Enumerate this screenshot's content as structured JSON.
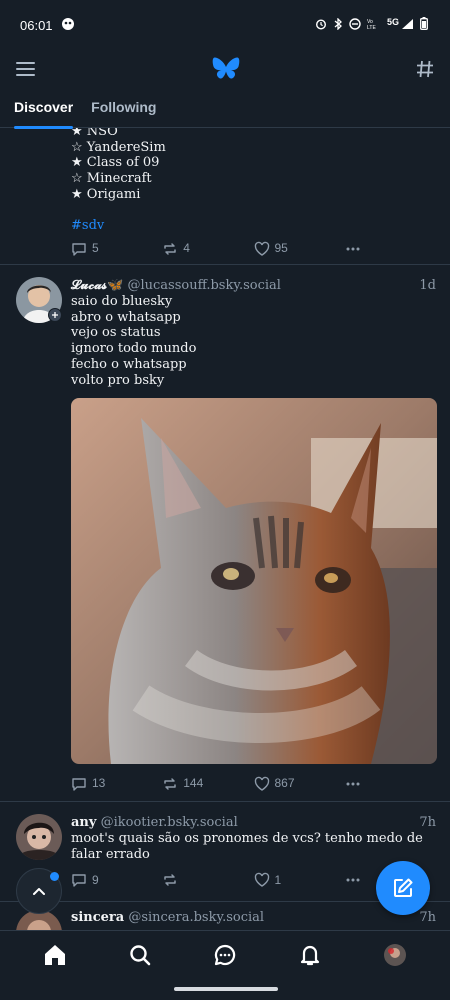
{
  "status_bar": {
    "time": "06:01",
    "network": "5G"
  },
  "header": {
    "menu_icon": "menu-icon",
    "logo": "butterfly-logo",
    "feeds_icon": "hash-icon"
  },
  "tabs": [
    {
      "label": "Discover",
      "active": true
    },
    {
      "label": "Following",
      "active": false
    }
  ],
  "posts": [
    {
      "lines": [
        "★ NSO",
        "☆ YandereSim",
        "★ Class of 09",
        "☆ Minecraft",
        "★ Origami"
      ],
      "hashtag": "#sdv",
      "replies": "5",
      "reposts": "4",
      "likes": "95"
    },
    {
      "author": "𝓛𝓾𝓬𝓪𝓼🦋",
      "handle": "@lucassouff.bsky.social",
      "time": "1d",
      "lines": [
        "saio do bluesky",
        "abro o whatsapp",
        "vejo os status",
        "ignoro todo mundo",
        "fecho o whatsapp",
        "volto pro bsky"
      ],
      "replies": "13",
      "reposts": "144",
      "likes": "867"
    },
    {
      "author": "any",
      "handle": "@ikootier.bsky.social",
      "time": "7h",
      "text": "moot's quais são os pronomes de vcs? tenho medo de falar errado",
      "replies": "9",
      "reposts": "",
      "likes": "1"
    },
    {
      "author": "sincera",
      "handle": "@sincera.bsky.social",
      "time": "7h"
    }
  ],
  "colors": {
    "background": "#161e27",
    "accent": "#208bfe",
    "muted": "#8d9aa8",
    "divider": "#2e3a47"
  }
}
